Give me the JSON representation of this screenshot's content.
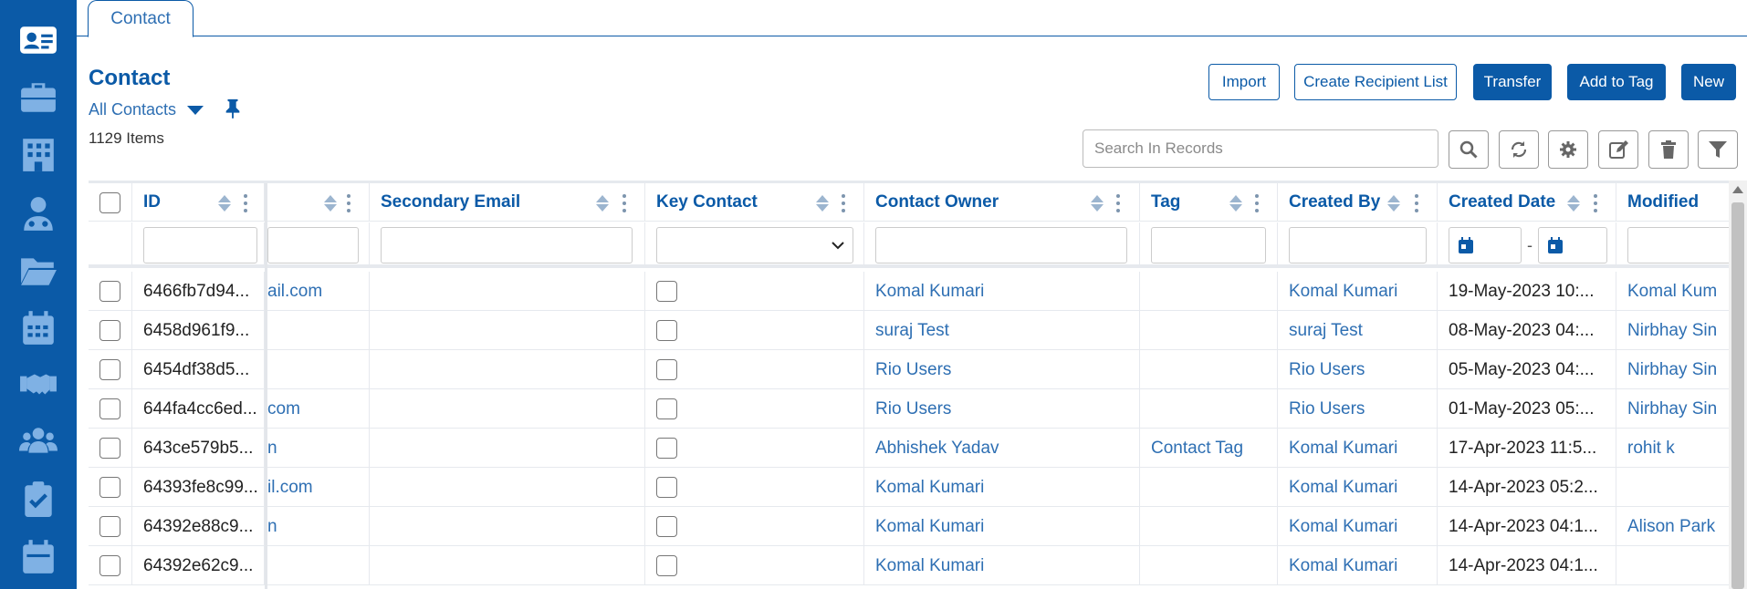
{
  "sidebar": {
    "icons": [
      "contact-card-icon",
      "briefcase-icon",
      "building-icon",
      "user-tie-icon",
      "folder-open-icon",
      "calendar-icon",
      "handshake-icon",
      "users-icon",
      "clipboard-check-icon",
      "calendar-alt-icon"
    ]
  },
  "tab": {
    "label": "Contact"
  },
  "header": {
    "title": "Contact",
    "view": "All Contacts",
    "count": "1129 Items"
  },
  "actions": {
    "import": "Import",
    "create_recipient_list": "Create Recipient List",
    "transfer": "Transfer",
    "add_to_tag": "Add to Tag",
    "new": "New"
  },
  "search": {
    "placeholder": "Search In Records"
  },
  "table": {
    "columns": {
      "id": "ID",
      "email": "",
      "secondary_email": "Secondary Email",
      "key_contact": "Key Contact",
      "contact_owner": "Contact Owner",
      "tag": "Tag",
      "created_by": "Created By",
      "created_date": "Created Date",
      "modified": "Modified"
    },
    "date_separator": "-",
    "rows": [
      {
        "id": "6466fb7d94...",
        "email": "ail.com",
        "owner": "Komal Kumari",
        "tag": "",
        "created_by": "Komal Kumari",
        "created_date": "19-May-2023 10:...",
        "modified": "Komal Kum"
      },
      {
        "id": "6458d961f9...",
        "email": "",
        "owner": "suraj Test",
        "tag": "",
        "created_by": "suraj Test",
        "created_date": "08-May-2023 04:...",
        "modified": "Nirbhay Sin"
      },
      {
        "id": "6454df38d5...",
        "email": "",
        "owner": "Rio Users",
        "tag": "",
        "created_by": "Rio Users",
        "created_date": "05-May-2023 04:...",
        "modified": "Nirbhay Sin"
      },
      {
        "id": "644fa4cc6ed...",
        "email": "com",
        "owner": "Rio Users",
        "tag": "",
        "created_by": "Rio Users",
        "created_date": "01-May-2023 05:...",
        "modified": "Nirbhay Sin"
      },
      {
        "id": "643ce579b5...",
        "email": "n",
        "owner": "Abhishek Yadav",
        "tag": "Contact Tag",
        "created_by": "Komal Kumari",
        "created_date": "17-Apr-2023 11:5...",
        "modified": "rohit k"
      },
      {
        "id": "64393fe8c99...",
        "email": "il.com",
        "owner": "Komal Kumari",
        "tag": "",
        "created_by": "Komal Kumari",
        "created_date": "14-Apr-2023 05:2...",
        "modified": ""
      },
      {
        "id": "64392e88c9...",
        "email": "n",
        "owner": "Komal Kumari",
        "tag": "",
        "created_by": "Komal Kumari",
        "created_date": "14-Apr-2023 04:1...",
        "modified": "Alison Park"
      },
      {
        "id": "64392e62c9...",
        "email": "",
        "owner": "Komal Kumari",
        "tag": "",
        "created_by": "Komal Kumari",
        "created_date": "14-Apr-2023 04:1...",
        "modified": ""
      }
    ]
  },
  "colors": {
    "primary": "#0b5aa7",
    "link": "#2e6fb3",
    "sidebar_icon": "#7fb1e4"
  }
}
